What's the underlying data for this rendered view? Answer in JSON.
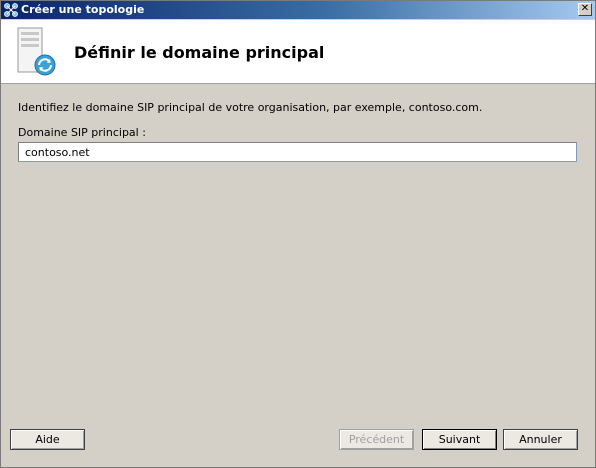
{
  "window": {
    "title": "Créer une topologie"
  },
  "header": {
    "title": "Définir le domaine principal",
    "icon": "server-domain-icon"
  },
  "content": {
    "description": "Identifiez le domaine SIP principal de votre organisation, par exemple, contoso.com.",
    "field_label": "Domaine SIP principal :",
    "field_value": "contoso.net"
  },
  "buttons": {
    "help": "Aide",
    "previous": "Précédent",
    "next": "Suivant",
    "cancel": "Annuler"
  }
}
